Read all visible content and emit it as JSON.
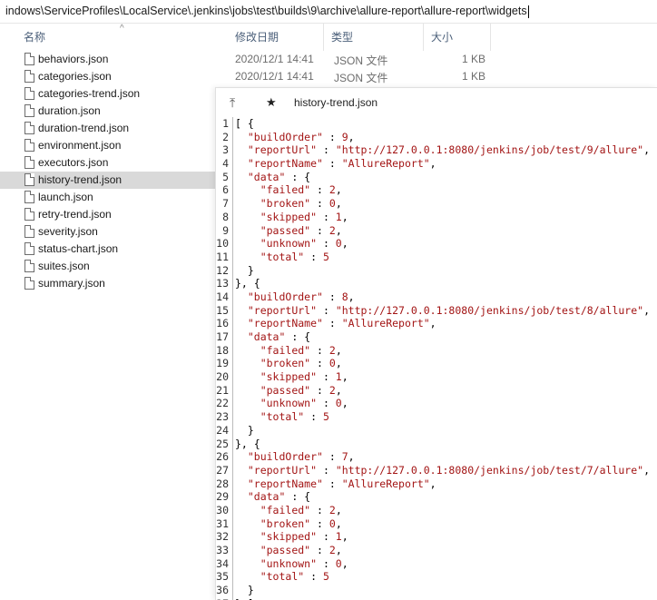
{
  "address_bar": {
    "path": "indows\\ServiceProfiles\\LocalService\\.jenkins\\jobs\\test\\builds\\9\\archive\\allure-report\\allure-report\\widgets"
  },
  "columns": {
    "name": "名称",
    "modified": "修改日期",
    "type": "类型",
    "size": "大小"
  },
  "files": [
    {
      "name": "behaviors.json",
      "modified": "2020/12/1 14:41",
      "type": "JSON 文件",
      "size": "1 KB"
    },
    {
      "name": "categories.json",
      "modified": "2020/12/1 14:41",
      "type": "JSON 文件",
      "size": "1 KB"
    },
    {
      "name": "categories-trend.json"
    },
    {
      "name": "duration.json"
    },
    {
      "name": "duration-trend.json"
    },
    {
      "name": "environment.json"
    },
    {
      "name": "executors.json"
    },
    {
      "name": "history-trend.json",
      "selected": true
    },
    {
      "name": "launch.json"
    },
    {
      "name": "retry-trend.json"
    },
    {
      "name": "severity.json"
    },
    {
      "name": "status-chart.json"
    },
    {
      "name": "suites.json"
    },
    {
      "name": "summary.json"
    }
  ],
  "preview": {
    "title": "history-trend.json",
    "builds": [
      {
        "buildOrder": "9",
        "reportUrl": "\"http://127.0.0.1:8080/jenkins/job/test/9/allure\"",
        "reportName": "\"AllureReport\"",
        "failed": "2",
        "broken": "0",
        "skipped": "1",
        "passed": "2",
        "unknown": "0",
        "total": "5"
      },
      {
        "buildOrder": "8",
        "reportUrl": "\"http://127.0.0.1:8080/jenkins/job/test/8/allure\"",
        "reportName": "\"AllureReport\"",
        "failed": "2",
        "broken": "0",
        "skipped": "1",
        "passed": "2",
        "unknown": "0",
        "total": "5"
      },
      {
        "buildOrder": "7",
        "reportUrl": "\"http://127.0.0.1:8080/jenkins/job/test/7/allure\"",
        "reportName": "\"AllureReport\"",
        "failed": "2",
        "broken": "0",
        "skipped": "1",
        "passed": "2",
        "unknown": "0",
        "total": "5"
      }
    ]
  }
}
